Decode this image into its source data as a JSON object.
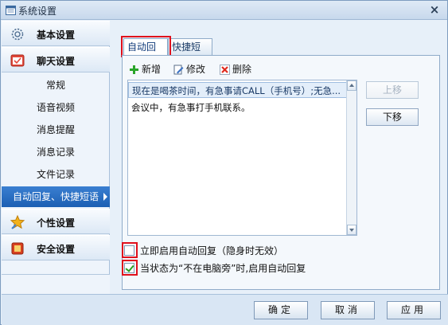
{
  "window": {
    "title": "系统设置",
    "close_glyph": "×"
  },
  "sidebar": {
    "categories": [
      {
        "label": "基本设置",
        "icon": "gear-icon"
      },
      {
        "label": "聊天设置",
        "icon": "chat-icon"
      },
      {
        "label": "个性设置",
        "icon": "star-icon"
      },
      {
        "label": "安全设置",
        "icon": "shield-icon"
      }
    ],
    "chat_items": [
      {
        "label": "常规"
      },
      {
        "label": "语音视频"
      },
      {
        "label": "消息提醒"
      },
      {
        "label": "消息记录"
      },
      {
        "label": "文件记录"
      },
      {
        "label": "自动回复、快捷短语"
      }
    ],
    "selected_item": "自动回复、快捷短语"
  },
  "tabs": [
    {
      "label": "自动回复",
      "active": true
    },
    {
      "label": "快捷短语",
      "active": false
    }
  ],
  "toolbar": {
    "add_label": "新增",
    "edit_label": "修改",
    "delete_label": "删除"
  },
  "reply_list": {
    "items": [
      {
        "text": "现在是喝茶时间，有急事请CALL（手机号）;无急..."
      },
      {
        "text": "会议中，有急事打手机联系。"
      }
    ],
    "selected_index": 0
  },
  "move_buttons": {
    "up_label": "上移",
    "down_label": "下移"
  },
  "options": {
    "enable_now_label": "立即启用自动回复（隐身时无效）",
    "enable_now_checked": false,
    "away_label": "当状态为“不在电脑旁”时,启用自动回复",
    "away_checked": true
  },
  "footer": {
    "ok_label": "确定",
    "cancel_label": "取消",
    "apply_label": "应用"
  },
  "colors": {
    "selection_blue": "#2a6fc4",
    "highlight_red": "#e0101c",
    "check_green": "#26a01f"
  }
}
